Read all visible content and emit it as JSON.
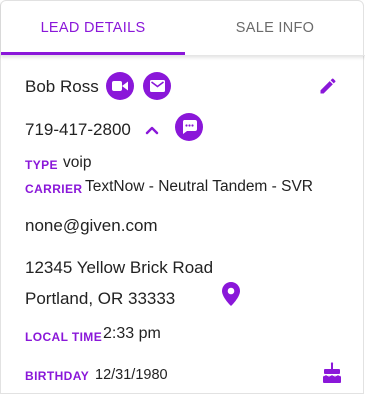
{
  "tabs": {
    "lead_details": "LEAD DETAILS",
    "sale_info": "SALE INFO"
  },
  "lead": {
    "name": "Bob Ross",
    "phone": "719-417-2800",
    "type_label": "TYPE",
    "type_value": "voip",
    "carrier_label": "CARRIER",
    "carrier_value": "TextNow - Neutral Tandem - SVR",
    "email": "none@given.com",
    "address_line1": "12345 Yellow Brick Road",
    "address_line2": "Portland, OR 33333",
    "local_time_label": "LOCAL TIME",
    "local_time_value": "2:33 pm",
    "birthday_label": "BIRTHDAY",
    "birthday_value": "12/31/1980"
  },
  "icons": {
    "video": "video-camera-icon",
    "email": "envelope-icon",
    "edit": "pencil-icon",
    "collapse": "chevron-up-icon",
    "sms": "chat-bubble-icon",
    "map": "map-pin-icon",
    "birthday": "cake-icon"
  },
  "colors": {
    "accent": "#8a17d9",
    "text": "#222222",
    "inactive_tab": "#6b6b6b"
  }
}
